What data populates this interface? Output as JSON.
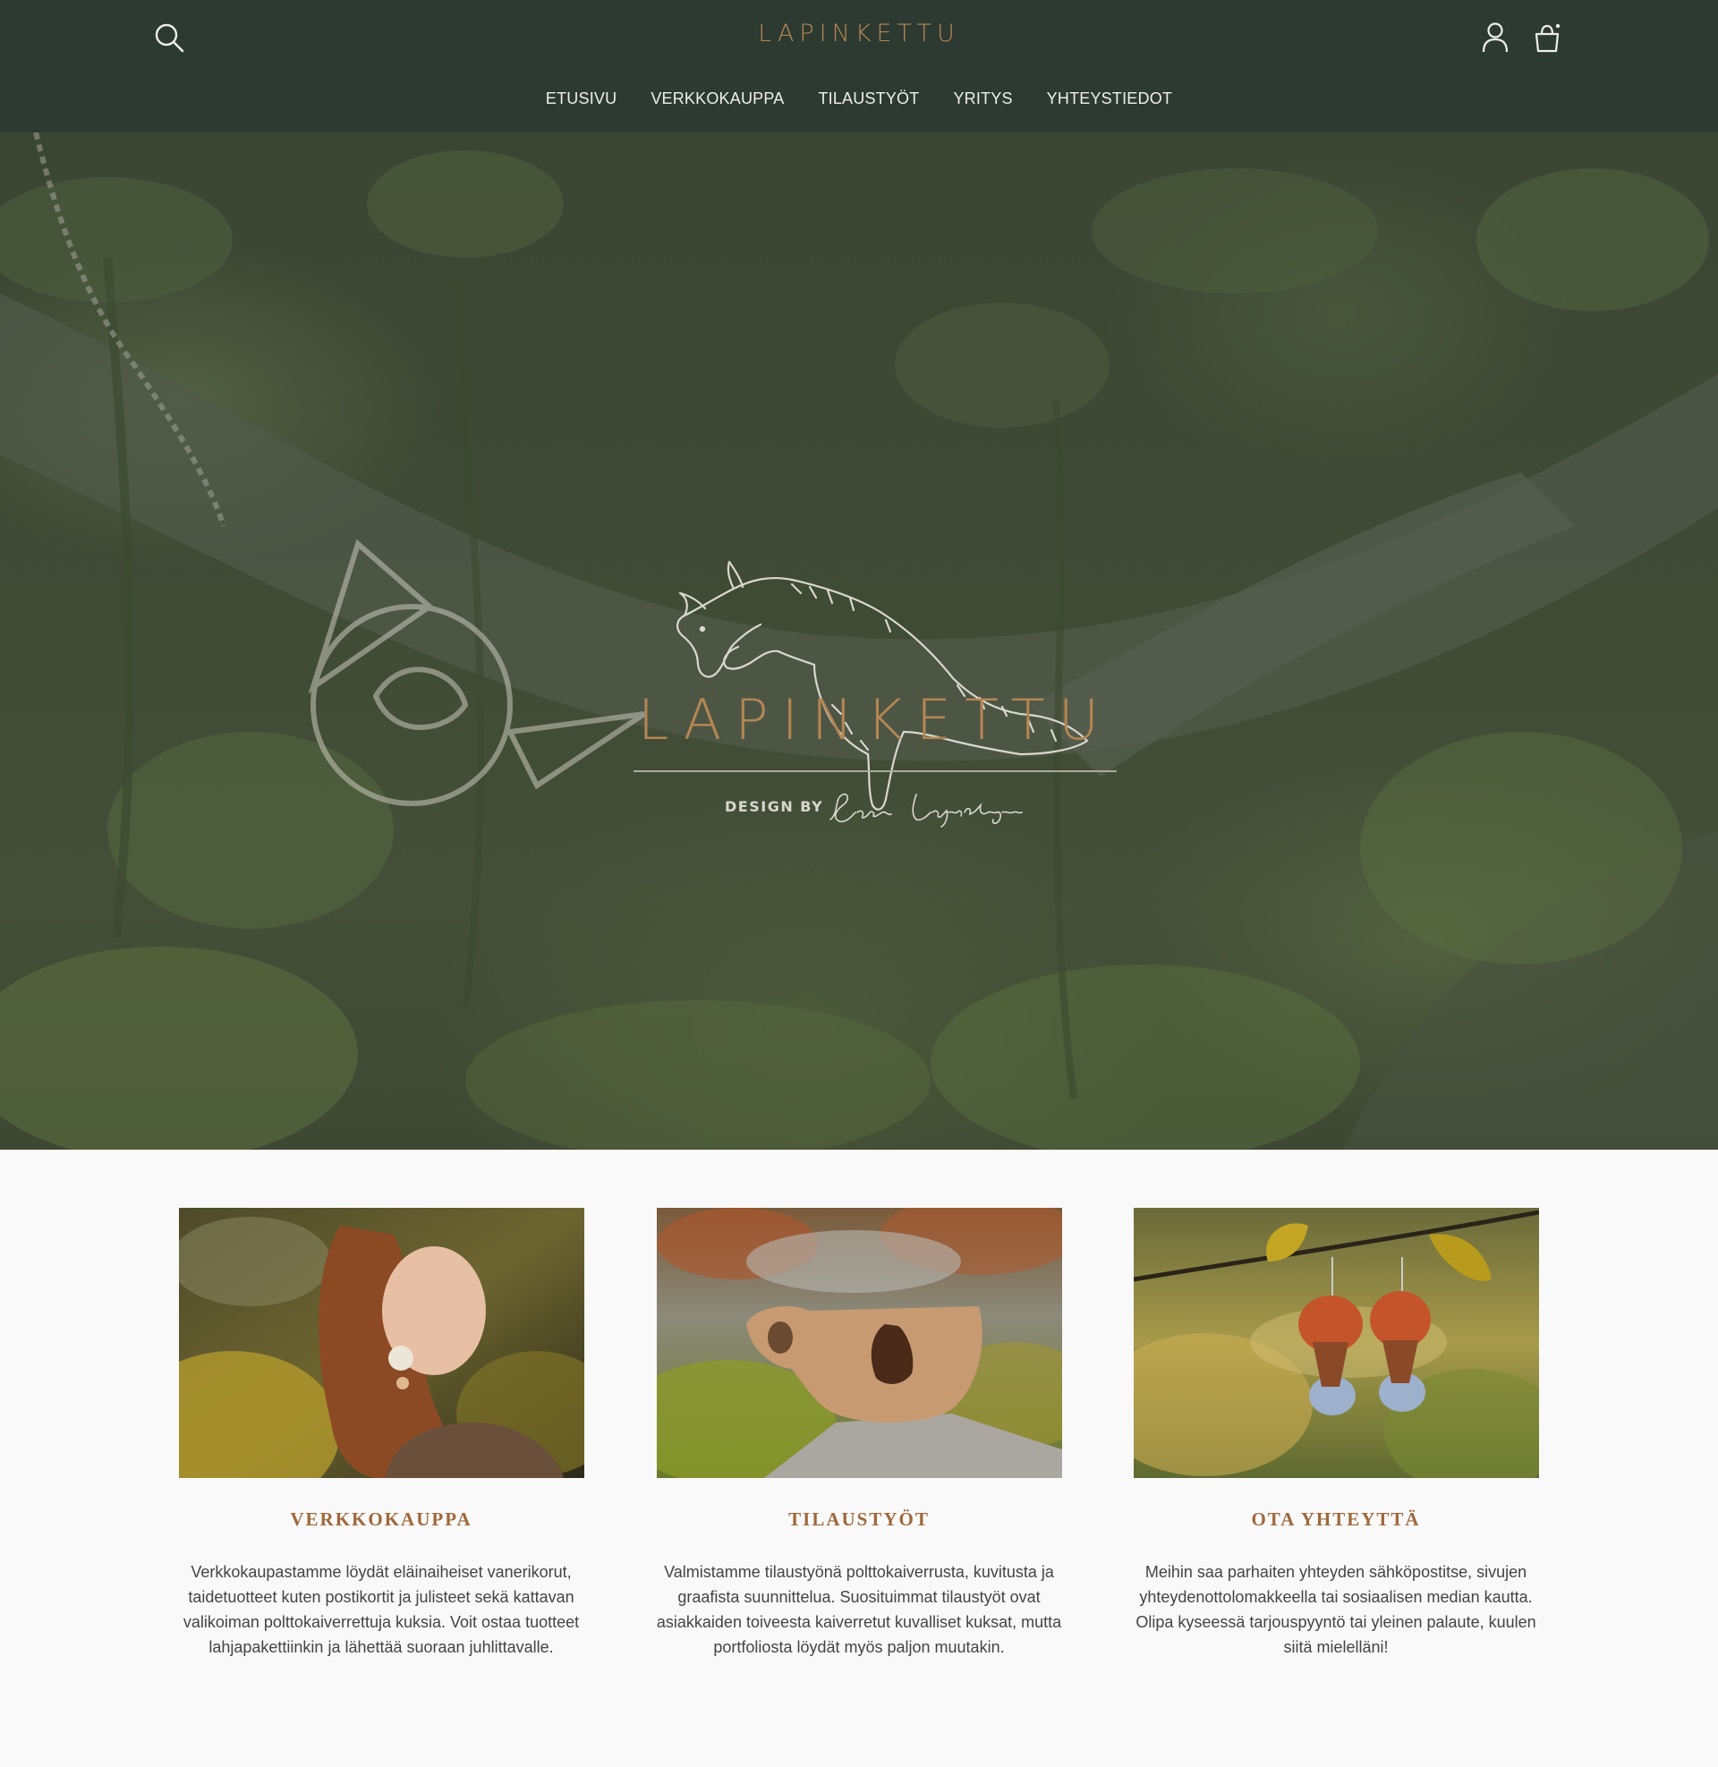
{
  "header": {
    "brand": "LAPINKETTU",
    "search_icon": "search-icon",
    "account_icon": "user-icon",
    "cart_icon": "shopping-bag-icon"
  },
  "nav": {
    "items": [
      {
        "label": "ETUSIVU"
      },
      {
        "label": "VERKKOKAUPPA"
      },
      {
        "label": "TILAUSTYÖT"
      },
      {
        "label": "YRITYS"
      },
      {
        "label": "YHTEYSTIEDOT"
      }
    ]
  },
  "hero": {
    "logo_icon": "jumping-fox-icon",
    "title": "LAPINKETTU",
    "design_by": "DESIGN BY",
    "signature": "Saana Lapinkangas"
  },
  "cards": [
    {
      "title": "VERKKOKAUPPA",
      "text": "Verkkokaupastamme löydät eläinaiheiset vanerikorut, taidetuotteet kuten postikortit ja julisteet sekä kattavan valikoiman polttokaiverrettuja kuksia. Voit ostaa tuotteet lahjapakettiinkin ja lähettää suoraan juhlittavalle."
    },
    {
      "title": "TILAUSTYÖT",
      "text": "Valmistamme tilaustyönä polttokaiverrusta, kuvitusta ja graafista suunnittelua. Suosituimmat tilaustyöt ovat asiakkaiden toiveesta kaiverretut kuvalliset kuksat, mutta portfoliosta löydät myös paljon muutakin."
    },
    {
      "title": "OTA YHTEYTTÄ",
      "text": "Meihin saa parhaiten yhteyden sähköpostitse, sivujen yhteydenottolomakkeella tai sosiaalisen median kautta. Olipa kyseessä tarjouspyyntö tai yleinen palaute, kuulen siitä mielelläni!"
    }
  ],
  "colors": {
    "header_bg": "#2d3a31",
    "accent": "#b58652",
    "heading": "#a0683b",
    "page_bg": "#f9f9f9"
  }
}
